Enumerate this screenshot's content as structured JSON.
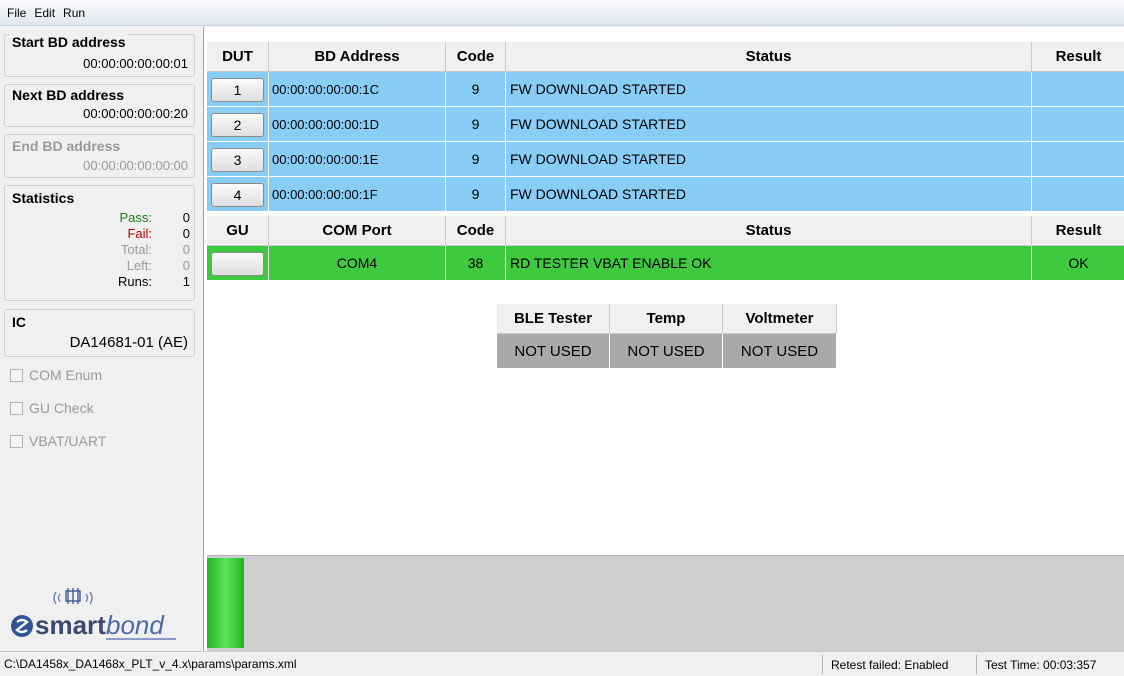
{
  "menu": [
    "File",
    "Edit",
    "Run"
  ],
  "left": {
    "start_bd": {
      "title": "Start BD address",
      "value": "00:00:00:00:00:01"
    },
    "next_bd": {
      "title": "Next BD address",
      "value": "00:00:00:00:00:20"
    },
    "end_bd": {
      "title": "End BD address",
      "value": "00:00:00:00:00:00"
    },
    "statistics": {
      "title": "Statistics",
      "rows": [
        {
          "label": "Pass:",
          "value": "0"
        },
        {
          "label": "Fail:",
          "value": "0"
        },
        {
          "label": "Total:",
          "value": "0"
        },
        {
          "label": "Left:",
          "value": "0"
        },
        {
          "label": "Runs:",
          "value": "1"
        }
      ]
    },
    "ic": {
      "title": "IC",
      "value": "DA14681-01 (AE)"
    },
    "checkboxes": [
      {
        "label": "COM Enum",
        "checked": false
      },
      {
        "label": "GU Check",
        "checked": false
      },
      {
        "label": "VBAT/UART",
        "checked": false
      }
    ],
    "logo": {
      "text_bold": "smart",
      "text_italic": "bond"
    }
  },
  "dut_table": {
    "headers": [
      "DUT",
      "BD Address",
      "Code",
      "Status",
      "Result"
    ],
    "rows": [
      {
        "num": "1",
        "bd": "00:00:00:00:00:1C",
        "code": "9",
        "status": "FW DOWNLOAD STARTED",
        "result": ""
      },
      {
        "num": "2",
        "bd": "00:00:00:00:00:1D",
        "code": "9",
        "status": "FW DOWNLOAD STARTED",
        "result": ""
      },
      {
        "num": "3",
        "bd": "00:00:00:00:00:1E",
        "code": "9",
        "status": "FW DOWNLOAD STARTED",
        "result": ""
      },
      {
        "num": "4",
        "bd": "00:00:00:00:00:1F",
        "code": "9",
        "status": "FW DOWNLOAD STARTED",
        "result": ""
      }
    ]
  },
  "gu_table": {
    "headers": [
      "GU",
      "COM Port",
      "Code",
      "Status",
      "Result"
    ],
    "row": {
      "num": "",
      "port": "COM4",
      "code": "38",
      "status": "RD TESTER VBAT ENABLE OK",
      "result": "OK"
    }
  },
  "instruments": {
    "headers": [
      "BLE Tester",
      "Temp",
      "Voltmeter"
    ],
    "values": [
      "NOT USED",
      "NOT USED",
      "NOT USED"
    ]
  },
  "progress": {
    "fraction": 0.04
  },
  "statusbar": {
    "path": "C:\\DA1458x_DA1468x_PLT_v_4.x\\params\\params.xml",
    "retest": "Retest failed: Enabled",
    "test_time": "Test Time: 00:03:357"
  },
  "colors": {
    "dut_row": "#87cdf5",
    "gu_row": "#3ec93e",
    "progress": "#22b322"
  }
}
